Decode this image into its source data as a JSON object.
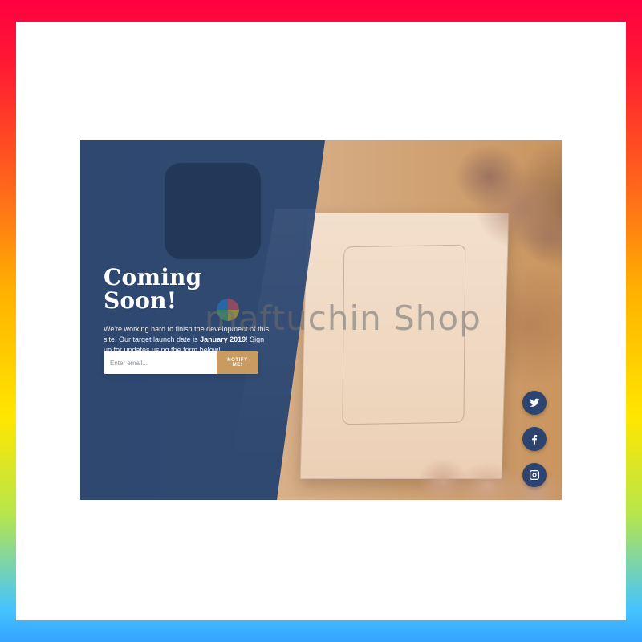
{
  "hero": {
    "title": "Coming Soon!",
    "description_part1": "We're working hard to finish the development of this site. Our target launch date is ",
    "description_bold": "January 2019",
    "description_part2": "! Sign up for updates using the form below!"
  },
  "form": {
    "email_placeholder": "Enter email...",
    "notify_label": "NOTIFY ME!"
  },
  "social": {
    "icons": [
      "twitter-icon",
      "facebook-icon",
      "instagram-icon"
    ]
  },
  "watermark": {
    "text": "maftuchin Shop"
  },
  "colors": {
    "blue_overlay": "#294570",
    "button_gold": "#c99b61",
    "social_blue": "#2d4470"
  }
}
